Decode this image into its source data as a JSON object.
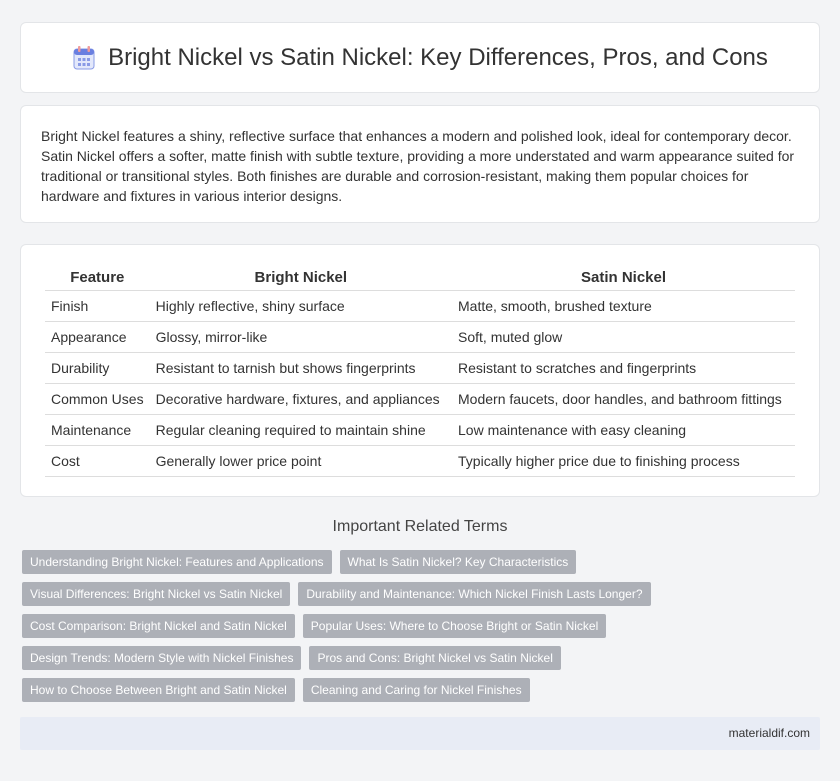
{
  "header": {
    "title": "Bright Nickel vs Satin Nickel: Key Differences, Pros, and Cons",
    "icon": "calendar-icon"
  },
  "intro": {
    "text": "Bright Nickel features a shiny, reflective surface that enhances a modern and polished look, ideal for contemporary decor. Satin Nickel offers a softer, matte finish with subtle texture, providing a more understated and warm appearance suited for traditional or transitional styles. Both finishes are durable and corrosion-resistant, making them popular choices for hardware and fixtures in various interior designs."
  },
  "table": {
    "headers": [
      "Feature",
      "Bright Nickel",
      "Satin Nickel"
    ],
    "rows": [
      [
        "Finish",
        "Highly reflective, shiny surface",
        "Matte, smooth, brushed texture"
      ],
      [
        "Appearance",
        "Glossy, mirror-like",
        "Soft, muted glow"
      ],
      [
        "Durability",
        "Resistant to tarnish but shows fingerprints",
        "Resistant to scratches and fingerprints"
      ],
      [
        "Common Uses",
        "Decorative hardware, fixtures, and appliances",
        "Modern faucets, door handles, and bathroom fittings"
      ],
      [
        "Maintenance",
        "Regular cleaning required to maintain shine",
        "Low maintenance with easy cleaning"
      ],
      [
        "Cost",
        "Generally lower price point",
        "Typically higher price due to finishing process"
      ]
    ]
  },
  "related": {
    "title": "Important Related Terms",
    "tags": [
      "Understanding Bright Nickel: Features and Applications",
      "What Is Satin Nickel? Key Characteristics",
      "Visual Differences: Bright Nickel vs Satin Nickel",
      "Durability and Maintenance: Which Nickel Finish Lasts Longer?",
      "Cost Comparison: Bright Nickel and Satin Nickel",
      "Popular Uses: Where to Choose Bright or Satin Nickel",
      "Design Trends: Modern Style with Nickel Finishes",
      "Pros and Cons: Bright Nickel vs Satin Nickel",
      "How to Choose Between Bright and Satin Nickel",
      "Cleaning and Caring for Nickel Finishes"
    ]
  },
  "footer": {
    "site": "materialdif.com"
  },
  "colors": {
    "tag_bg": "#adb0b7",
    "footer_bg": "#e8ecf5",
    "icon_accent": "#6a7fe0"
  }
}
